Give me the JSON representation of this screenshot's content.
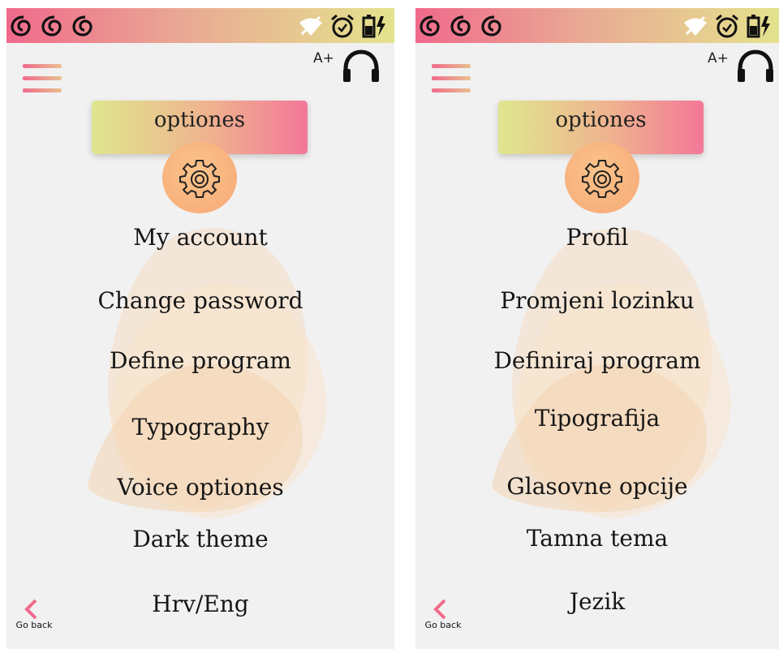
{
  "colors": {
    "status_gradient": [
      "#f06a8b",
      "#e9a894",
      "#e4e38d"
    ],
    "title_gradient": [
      "#dfe68e",
      "#efb28f",
      "#f37798"
    ],
    "gear_circle": "#f8b07c",
    "back_arrow": "#f06a8b",
    "screen_bg": "#f1f1f1"
  },
  "icons": {
    "status_left": [
      "signal-swirl-icon",
      "signal-swirl-icon",
      "signal-swirl-icon"
    ],
    "status_right": [
      "wifi-off-icon",
      "alarm-icon",
      "battery-charging-icon"
    ],
    "menu": "hamburger-menu-icon",
    "accessibility": "headphones-icon",
    "settings": "gear-icon",
    "back": "chevron-left-icon"
  },
  "screens": [
    {
      "lang": "en",
      "font_size_label": "A+",
      "title": "optiones",
      "menu_items": [
        "My account",
        "Change password",
        "Define program",
        "Typography",
        "Voice optiones",
        "Dark theme",
        "Hrv/Eng"
      ],
      "back_label": "Go back"
    },
    {
      "lang": "hr",
      "font_size_label": "A+",
      "title": "optiones",
      "menu_items": [
        "Profil",
        "Promjeni lozinku",
        "Definiraj program",
        "Tipografija",
        "Glasovne opcije",
        "Tamna tema",
        "Jezik"
      ],
      "back_label": "Go back"
    }
  ]
}
